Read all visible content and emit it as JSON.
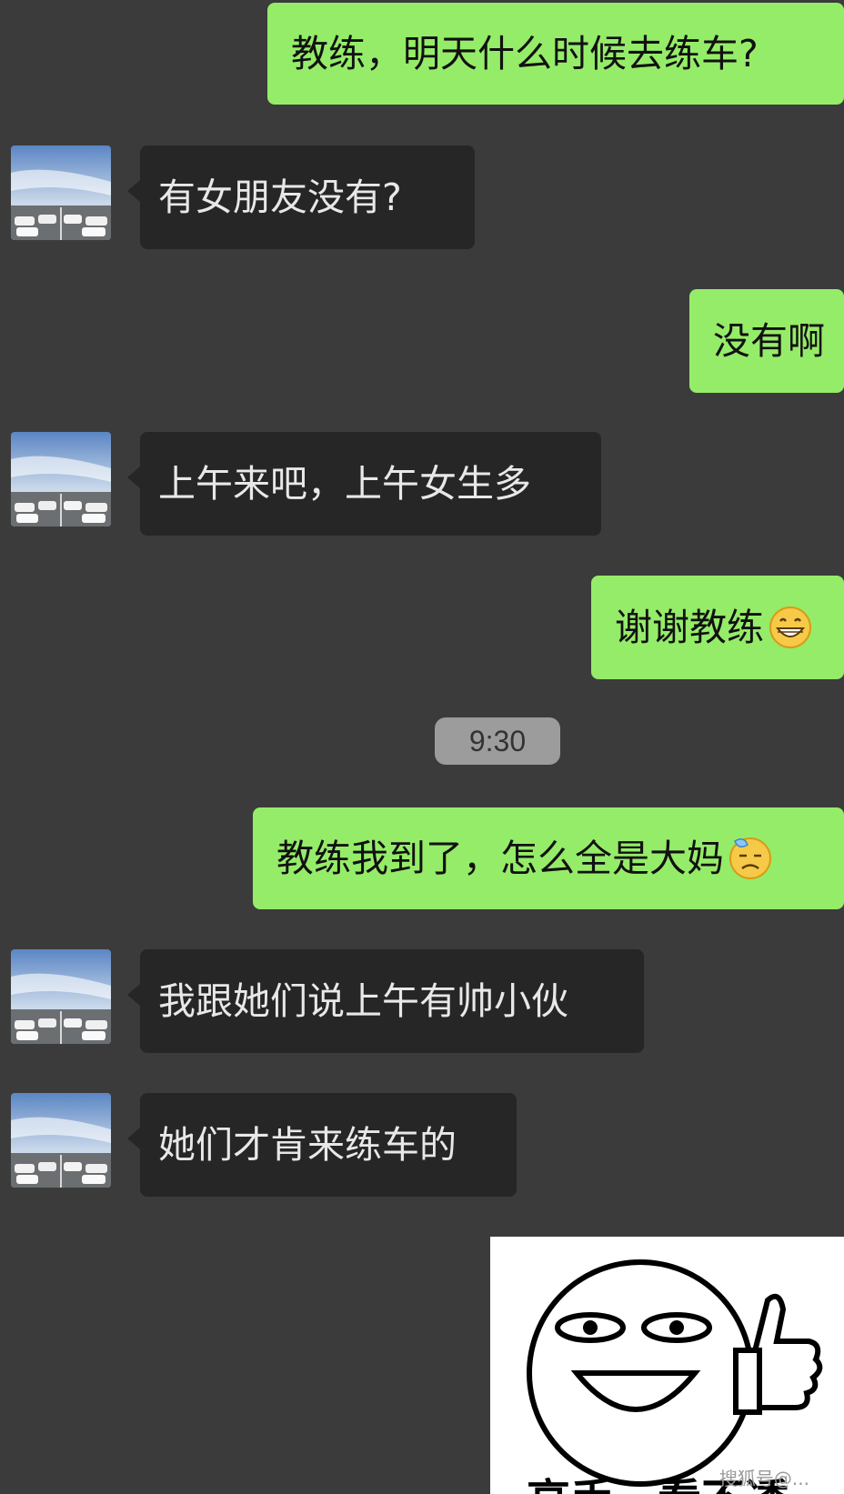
{
  "messages": [
    {
      "side": "sent",
      "text": "教练，明天什么时候去练车?"
    },
    {
      "side": "received",
      "text": "有女朋友没有?"
    },
    {
      "side": "sent",
      "text": "没有啊"
    },
    {
      "side": "received",
      "text": "上午来吧，上午女生多"
    },
    {
      "side": "sent",
      "text": "谢谢教练",
      "emoji": "grinning-face-icon"
    },
    {
      "side": "sent",
      "text": "教练我到了，怎么全是大妈",
      "emoji": "downcast-sweat-face-icon"
    },
    {
      "side": "received",
      "text": "我跟她们说上午有帅小伙"
    },
    {
      "side": "received",
      "text": "她们才肯来练车的"
    }
  ],
  "timestamp": "9:30",
  "sticker": {
    "caption": "高手，看不透",
    "icon": "thumbs-up-smiley-face-icon"
  },
  "watermark": "搜狐号@..."
}
